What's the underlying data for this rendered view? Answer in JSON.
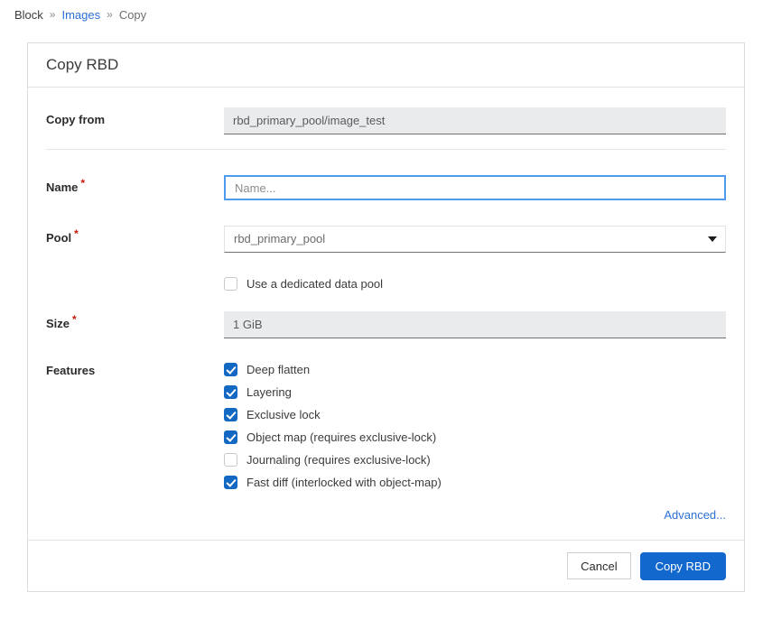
{
  "breadcrumb": {
    "items": [
      {
        "label": "Block",
        "style": "plain"
      },
      {
        "label": "Images",
        "style": "link"
      },
      {
        "label": "Copy",
        "style": "muted"
      }
    ],
    "separator": "»"
  },
  "card": {
    "title": "Copy RBD",
    "fields": {
      "copy_from": {
        "label": "Copy from",
        "value": "rbd_primary_pool/image_test",
        "required": false
      },
      "name": {
        "label": "Name",
        "value": "",
        "placeholder": "Name...",
        "required": true,
        "required_mark": "*"
      },
      "pool": {
        "label": "Pool",
        "value": "rbd_primary_pool",
        "required": true,
        "required_mark": "*",
        "caret_icon": "chevron-down-icon"
      },
      "dedicated_data_pool": {
        "label": "Use a dedicated data pool",
        "checked": false
      },
      "size": {
        "label": "Size",
        "value": "1 GiB",
        "required": true,
        "required_mark": "*"
      },
      "features": {
        "label": "Features",
        "items": [
          {
            "label": "Deep flatten",
            "checked": true
          },
          {
            "label": "Layering",
            "checked": true
          },
          {
            "label": "Exclusive lock",
            "checked": true
          },
          {
            "label": "Object map (requires exclusive-lock)",
            "checked": true
          },
          {
            "label": "Journaling (requires exclusive-lock)",
            "checked": false
          },
          {
            "label": "Fast diff (interlocked with object-map)",
            "checked": true
          }
        ]
      }
    },
    "advanced_link": "Advanced...",
    "footer": {
      "cancel_label": "Cancel",
      "submit_label": "Copy RBD"
    }
  },
  "colors": {
    "link": "#2b70d3",
    "primary": "#1368ce",
    "required": "#c9190b",
    "checkbox_on": "#1268c3",
    "focus_border": "#4e9bec",
    "disabled_bg": "#e9ebed"
  }
}
